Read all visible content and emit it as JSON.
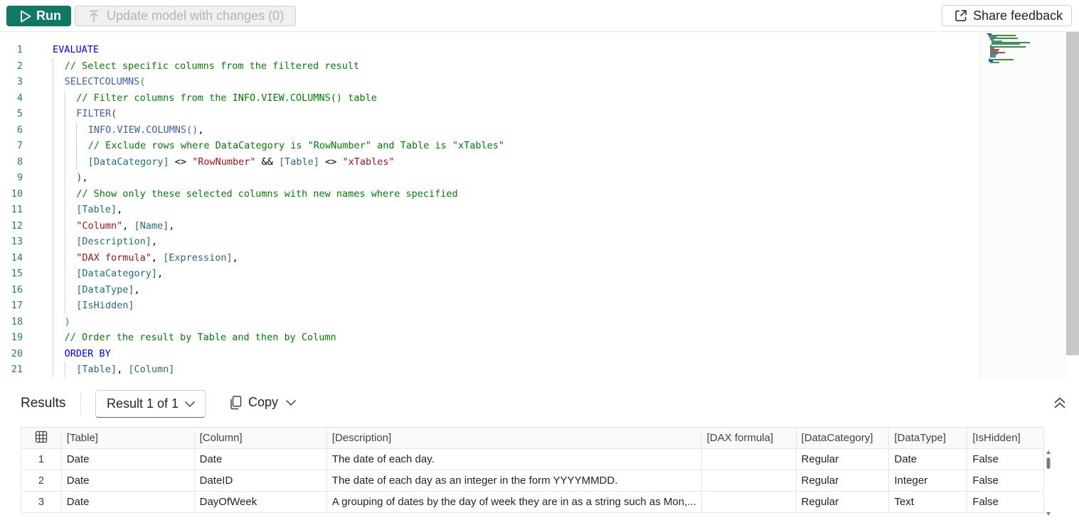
{
  "toolbar": {
    "run_label": "Run",
    "update_label": "Update model with changes (0)",
    "share_label": "Share feedback"
  },
  "editor": {
    "lines": [
      {
        "n": "1",
        "indent": 0,
        "tokens": [
          {
            "t": "EVALUATE",
            "c": "kw"
          }
        ]
      },
      {
        "n": "2",
        "indent": 1,
        "tokens": [
          {
            "t": "// Select specific columns from the filtered result",
            "c": "cm"
          }
        ]
      },
      {
        "n": "3",
        "indent": 1,
        "tokens": [
          {
            "t": "SELECTCOLUMNS",
            "c": "fn"
          },
          {
            "t": "(",
            "c": "br"
          }
        ]
      },
      {
        "n": "4",
        "indent": 2,
        "tokens": [
          {
            "t": "// Filter columns from the INFO.VIEW.COLUMNS() table",
            "c": "cm"
          }
        ]
      },
      {
        "n": "5",
        "indent": 2,
        "tokens": [
          {
            "t": "FILTER",
            "c": "fn"
          },
          {
            "t": "(",
            "c": "br2"
          }
        ]
      },
      {
        "n": "6",
        "indent": 3,
        "tokens": [
          {
            "t": "INFO.VIEW.COLUMNS",
            "c": "fn"
          },
          {
            "t": "()",
            "c": "fn"
          },
          {
            "t": ",",
            "c": "pl"
          }
        ]
      },
      {
        "n": "7",
        "indent": 3,
        "tokens": [
          {
            "t": "// Exclude rows where DataCategory is \"RowNumber\" and Table is \"xTables\"",
            "c": "cm"
          }
        ]
      },
      {
        "n": "8",
        "indent": 3,
        "tokens": [
          {
            "t": "[DataCategory]",
            "c": "col"
          },
          {
            "t": " <> ",
            "c": "pl"
          },
          {
            "t": "\"RowNumber\"",
            "c": "st"
          },
          {
            "t": " && ",
            "c": "pl"
          },
          {
            "t": "[Table]",
            "c": "col"
          },
          {
            "t": " <> ",
            "c": "pl"
          },
          {
            "t": "\"xTables\"",
            "c": "st"
          }
        ]
      },
      {
        "n": "9",
        "indent": 2,
        "tokens": [
          {
            "t": ")",
            "c": "br2"
          },
          {
            "t": ",",
            "c": "pl"
          }
        ]
      },
      {
        "n": "10",
        "indent": 2,
        "tokens": [
          {
            "t": "// Show only these selected columns with new names where specified",
            "c": "cm"
          }
        ]
      },
      {
        "n": "11",
        "indent": 2,
        "tokens": [
          {
            "t": "[Table]",
            "c": "col"
          },
          {
            "t": ",",
            "c": "pl"
          }
        ]
      },
      {
        "n": "12",
        "indent": 2,
        "tokens": [
          {
            "t": "\"Column\"",
            "c": "st"
          },
          {
            "t": ", ",
            "c": "pl"
          },
          {
            "t": "[Name]",
            "c": "col"
          },
          {
            "t": ",",
            "c": "pl"
          }
        ]
      },
      {
        "n": "13",
        "indent": 2,
        "tokens": [
          {
            "t": "[Description]",
            "c": "col"
          },
          {
            "t": ",",
            "c": "pl"
          }
        ]
      },
      {
        "n": "14",
        "indent": 2,
        "tokens": [
          {
            "t": "\"DAX formula\"",
            "c": "st"
          },
          {
            "t": ", ",
            "c": "pl"
          },
          {
            "t": "[Expression]",
            "c": "col"
          },
          {
            "t": ",",
            "c": "pl"
          }
        ]
      },
      {
        "n": "15",
        "indent": 2,
        "tokens": [
          {
            "t": "[DataCategory]",
            "c": "col"
          },
          {
            "t": ",",
            "c": "pl"
          }
        ]
      },
      {
        "n": "16",
        "indent": 2,
        "tokens": [
          {
            "t": "[DataType]",
            "c": "col"
          },
          {
            "t": ",",
            "c": "pl"
          }
        ]
      },
      {
        "n": "17",
        "indent": 2,
        "tokens": [
          {
            "t": "[IsHidden]",
            "c": "col"
          }
        ]
      },
      {
        "n": "18",
        "indent": 1,
        "tokens": [
          {
            "t": ")",
            "c": "br"
          }
        ]
      },
      {
        "n": "19",
        "indent": 1,
        "tokens": [
          {
            "t": "// Order the result by Table and then by Column",
            "c": "cm"
          }
        ]
      },
      {
        "n": "20",
        "indent": 1,
        "tokens": [
          {
            "t": "ORDER BY",
            "c": "kw"
          }
        ]
      },
      {
        "n": "21",
        "indent": 2,
        "tokens": [
          {
            "t": "[Table]",
            "c": "col"
          },
          {
            "t": ", ",
            "c": "pl"
          },
          {
            "t": "[Column]",
            "c": "col"
          }
        ]
      }
    ]
  },
  "results": {
    "title": "Results",
    "selector_label": "Result 1 of 1",
    "copy_label": "Copy",
    "columns": [
      "[Table]",
      "[Column]",
      "[Description]",
      "[DAX formula]",
      "[DataCategory]",
      "[DataType]",
      "[IsHidden]"
    ],
    "rows": [
      [
        "1",
        "Date",
        "Date",
        "The date of each day.",
        "",
        "Regular",
        "Date",
        "False"
      ],
      [
        "2",
        "Date",
        "DateID",
        "The date of each day as an integer in the form YYYYMMDD.",
        "",
        "Regular",
        "Integer",
        "False"
      ],
      [
        "3",
        "Date",
        "DayOfWeek",
        "A grouping of dates by the day of week they are in as a string such as Mon,...",
        "",
        "Regular",
        "Text",
        "False"
      ]
    ]
  }
}
